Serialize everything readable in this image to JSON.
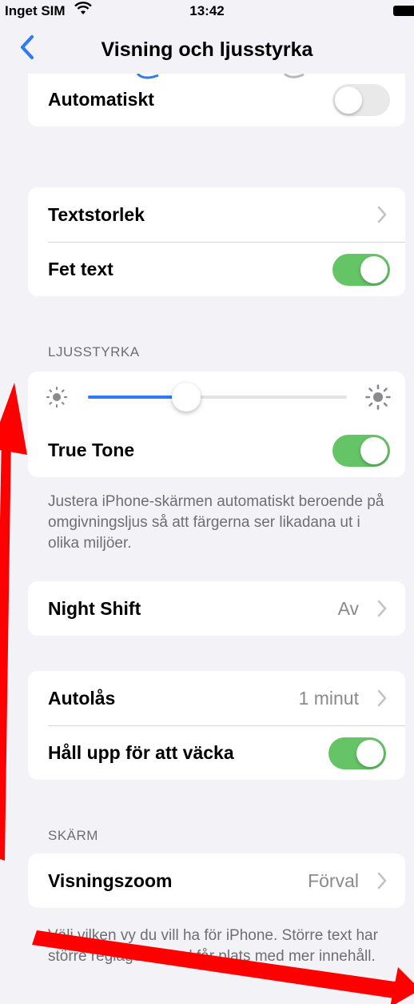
{
  "status_bar": {
    "carrier": "Inget SIM",
    "time": "13:42"
  },
  "nav": {
    "title": "Visning och ljusstyrka"
  },
  "sections": {
    "appearance": {
      "auto_label": "Automatiskt",
      "auto_on": false
    },
    "text": {
      "size_label": "Textstorlek",
      "bold_label": "Fet text",
      "bold_on": true
    },
    "brightness": {
      "header": "LJUSSTYRKA",
      "level": 0.38,
      "true_tone_label": "True Tone",
      "true_tone_on": true,
      "footer": "Justera iPhone-skärmen automatiskt beroende på omgivningsljus så att färgerna ser likadana ut i olika miljöer."
    },
    "night_shift": {
      "label": "Night Shift",
      "value": "Av"
    },
    "lock": {
      "autolock_label": "Autolås",
      "autolock_value": "1 minut",
      "raise_label": "Håll upp för att väcka",
      "raise_on": true
    },
    "display": {
      "header": "SKÄRM",
      "zoom_label": "Visningszoom",
      "zoom_value": "Förval",
      "footer": "Välj vilken vy du vill ha för iPhone. Större text har större reglage. Förval får plats med mer innehåll."
    }
  },
  "colors": {
    "accent": "#2f7bf5",
    "toggle_on": "#65c466",
    "annotation": "#ff0000"
  }
}
